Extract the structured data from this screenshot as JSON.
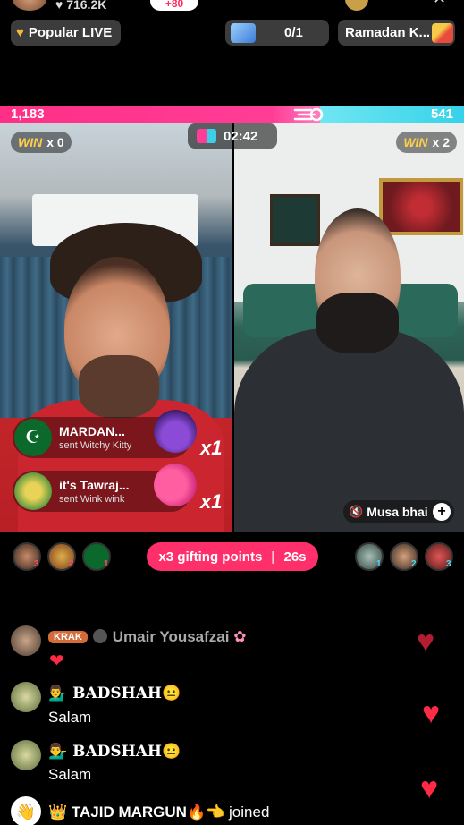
{
  "header": {
    "viewer_count": "716.2K",
    "follow_label": "+80"
  },
  "pills": {
    "popular_live": "Popular LIVE",
    "rank_value": "0/1",
    "ramadan": "Ramadan K..."
  },
  "battle": {
    "left_score": "1,183",
    "right_score": "541",
    "timer": "02:42",
    "left_win_label": "WIN",
    "left_win_count": "x 0",
    "right_win_label": "WIN",
    "right_win_count": "x 2",
    "right_host_name": "Musa bhai",
    "colors": {
      "left": "#ff2f86",
      "right": "#35d2ea"
    }
  },
  "gifts": [
    {
      "name": "MARDAN...",
      "sub": "sent Witchy Kitty",
      "mult": "x1"
    },
    {
      "name": "it's Tawraj...",
      "sub": "sent Wink wink",
      "mult": "x1"
    }
  ],
  "supporters": {
    "left_ranks": [
      "3",
      "2",
      "1"
    ],
    "right_ranks": [
      "1",
      "2",
      "3"
    ],
    "gifting_label": "x3 gifting points",
    "gifting_time": "26s"
  },
  "chat": [
    {
      "badge": "KRAK",
      "name": "Umair Yousafzai",
      "message": "❤"
    },
    {
      "name": "💁‍♂️ BADSHAH😐",
      "message": "Salam"
    },
    {
      "name": "💁‍♂️ BADSHAH😐",
      "message": "Salam"
    },
    {
      "name": "👑 TAJID MARGUN🔥👈",
      "message": "joined"
    }
  ]
}
